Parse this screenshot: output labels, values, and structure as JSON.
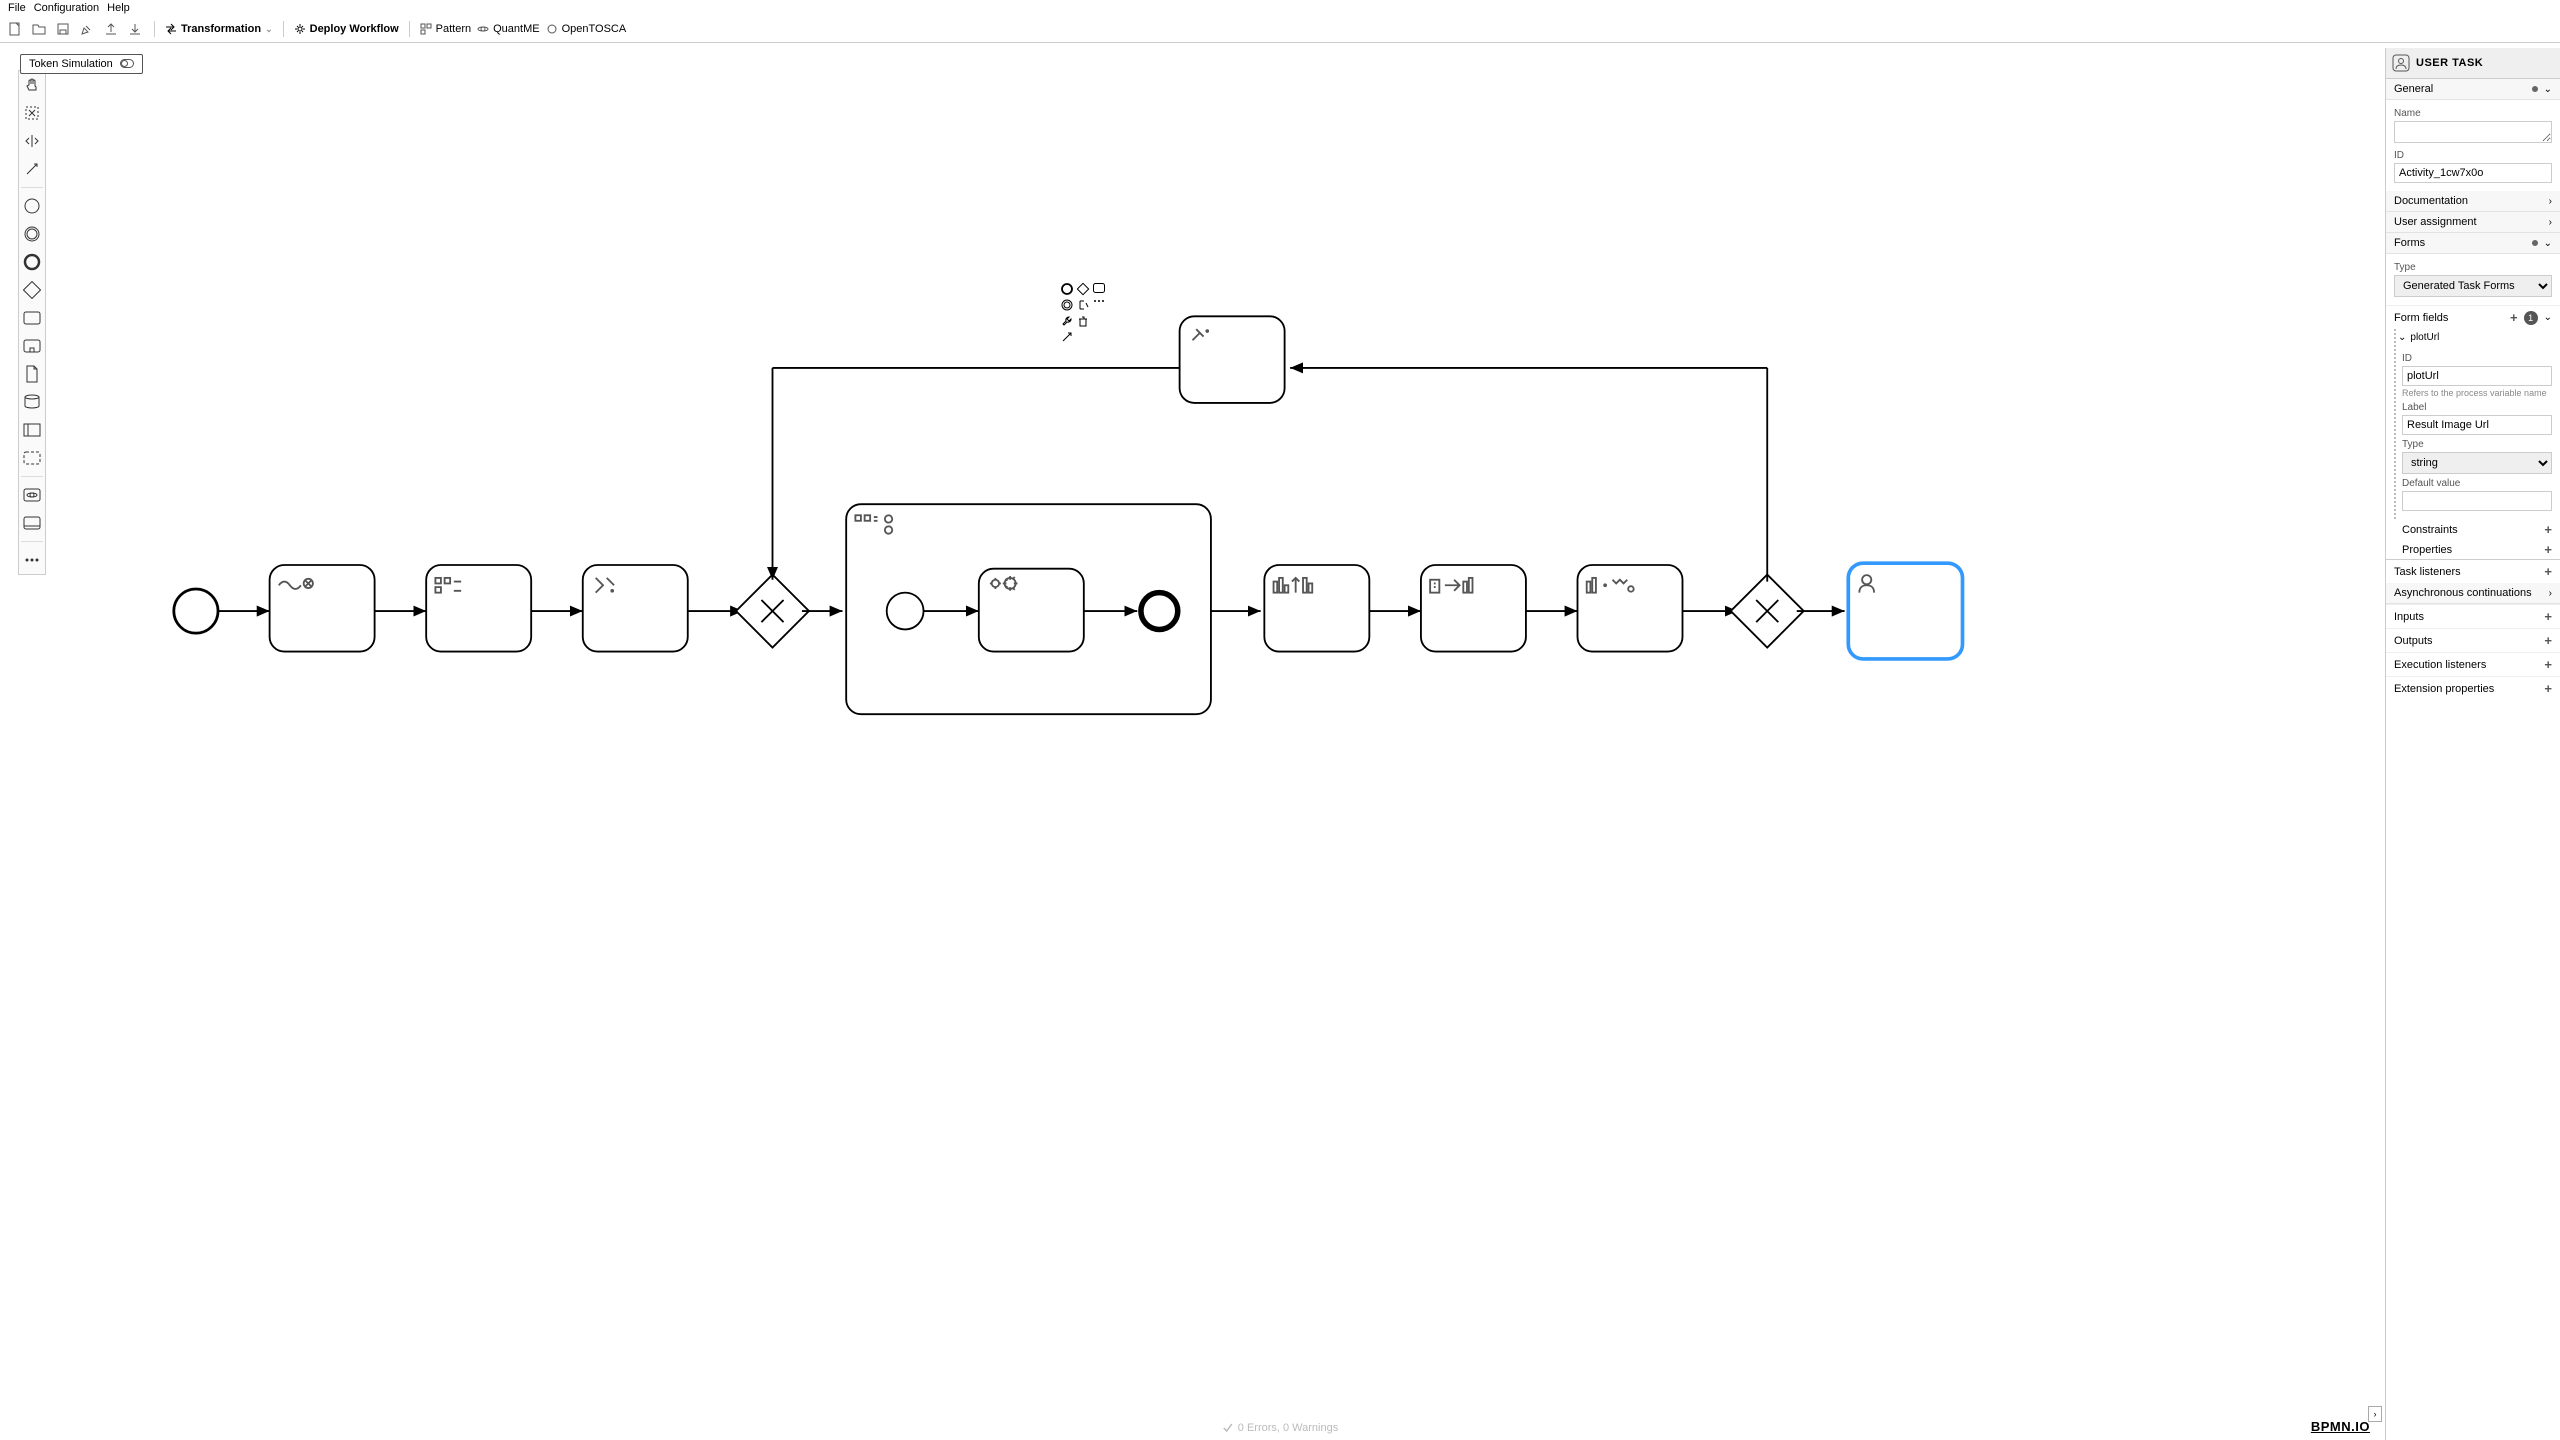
{
  "menu": {
    "file": "File",
    "config": "Configuration",
    "help": "Help"
  },
  "toolbar": {
    "transformation": "Transformation",
    "deploy": "Deploy Workflow",
    "pattern": "Pattern",
    "quantme": "QuantME",
    "opentosca": "OpenTOSCA"
  },
  "token_sim": "Token Simulation",
  "props": {
    "title": "USER TASK",
    "general": "General",
    "name_label": "Name",
    "id_label": "ID",
    "id_value": "Activity_1cw7x0o",
    "documentation": "Documentation",
    "user_assignment": "User assignment",
    "forms": "Forms",
    "type_label": "Type",
    "type_value": "Generated Task Forms",
    "form_fields": "Form fields",
    "form_fields_count": "1",
    "field_name": "plotUrl",
    "ff_id_label": "ID",
    "ff_id_value": "plotUrl",
    "ff_id_hint": "Refers to the process variable name",
    "ff_label_label": "Label",
    "ff_label_value": "Result Image Url",
    "ff_type_label": "Type",
    "ff_type_value": "string",
    "ff_default_label": "Default value",
    "constraints": "Constraints",
    "properties": "Properties",
    "task_listeners": "Task listeners",
    "async": "Asynchronous continuations",
    "inputs": "Inputs",
    "outputs": "Outputs",
    "exec_listeners": "Execution listeners",
    "ext_props": "Extension properties"
  },
  "status": "0 Errors, 0 Warnings",
  "logo": "BPMN.IO"
}
